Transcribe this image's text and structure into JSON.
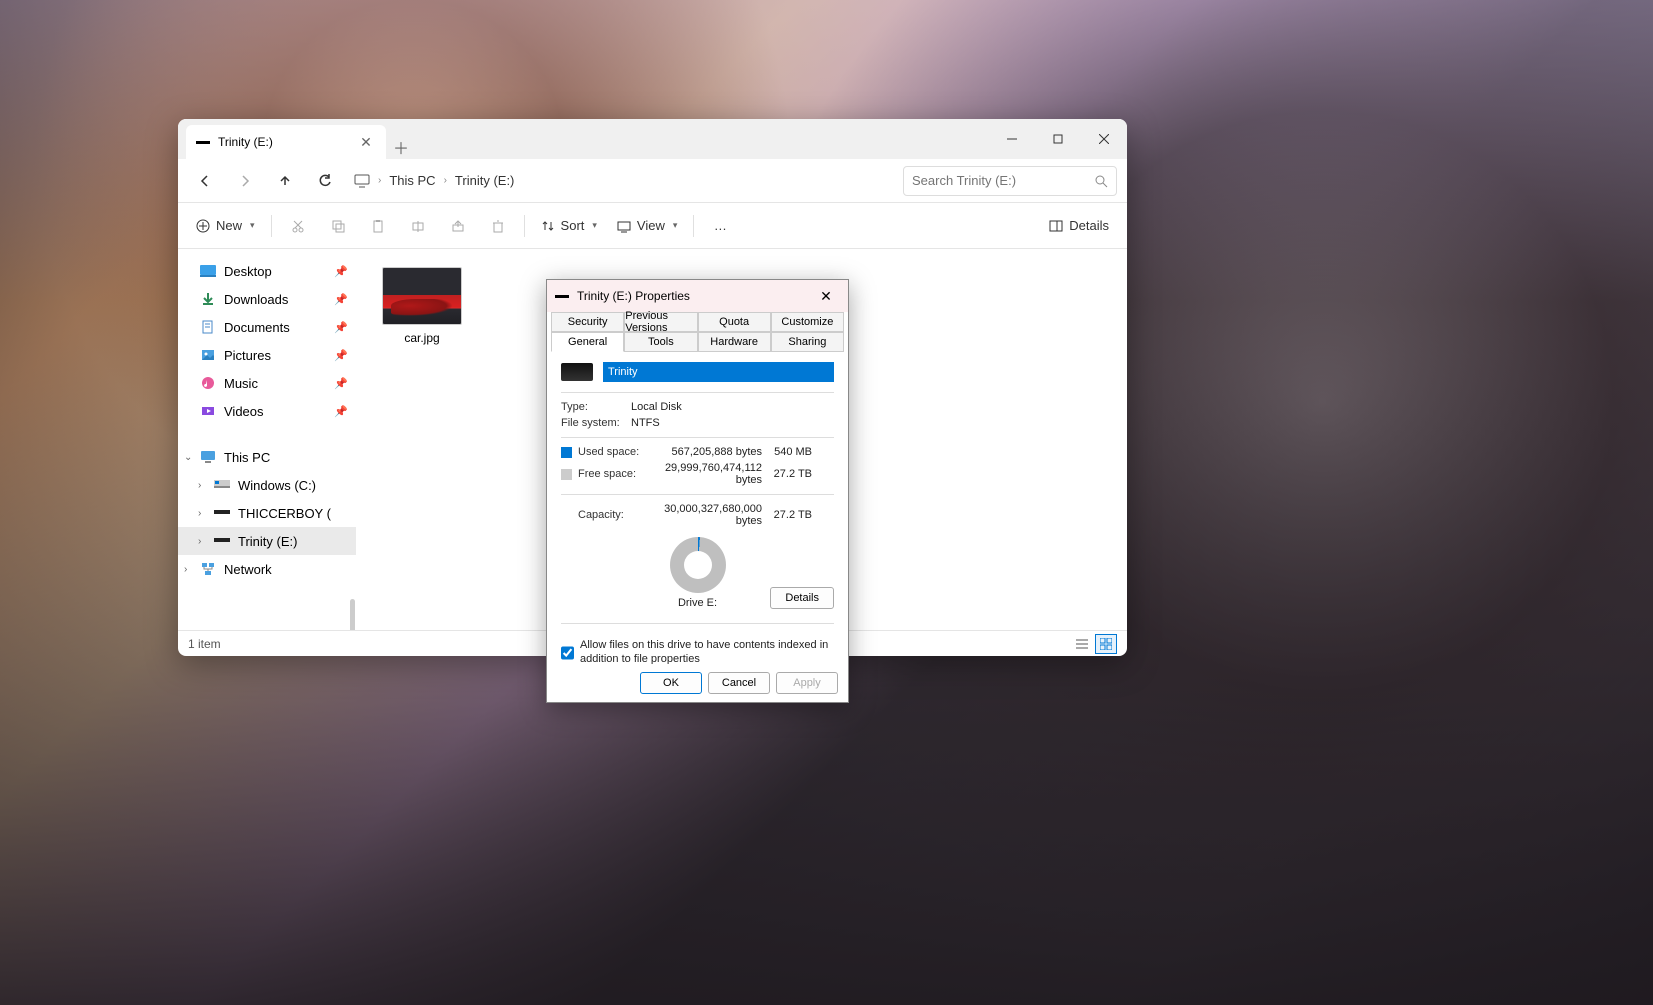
{
  "explorer": {
    "tab_title": "Trinity (E:)",
    "breadcrumb": {
      "items": [
        "This PC",
        "Trinity (E:)"
      ]
    },
    "search_placeholder": "Search Trinity (E:)",
    "toolbar": {
      "new": "New",
      "sort": "Sort",
      "view": "View",
      "details": "Details"
    },
    "sidebar": {
      "quick": [
        {
          "label": "Desktop",
          "icon": "desktop",
          "pinned": true
        },
        {
          "label": "Downloads",
          "icon": "downloads",
          "pinned": true
        },
        {
          "label": "Documents",
          "icon": "documents",
          "pinned": true
        },
        {
          "label": "Pictures",
          "icon": "pictures",
          "pinned": true
        },
        {
          "label": "Music",
          "icon": "music",
          "pinned": true
        },
        {
          "label": "Videos",
          "icon": "videos",
          "pinned": true
        }
      ],
      "thispc_label": "This PC",
      "drives": [
        {
          "label": "Windows (C:)"
        },
        {
          "label": "THICCERBOY ("
        },
        {
          "label": "Trinity (E:)",
          "selected": true
        }
      ],
      "network_label": "Network"
    },
    "files": [
      {
        "name": "car.jpg"
      }
    ],
    "status": "1 item"
  },
  "props": {
    "title": "Trinity (E:) Properties",
    "tabs_row1": [
      "Security",
      "Previous Versions",
      "Quota",
      "Customize"
    ],
    "tabs_row2": [
      "General",
      "Tools",
      "Hardware",
      "Sharing"
    ],
    "active_tab": "General",
    "drive_name": "Trinity",
    "type_label": "Type:",
    "type_value": "Local Disk",
    "fs_label": "File system:",
    "fs_value": "NTFS",
    "used_label": "Used space:",
    "used_bytes": "567,205,888 bytes",
    "used_human": "540 MB",
    "free_label": "Free space:",
    "free_bytes": "29,999,760,474,112 bytes",
    "free_human": "27.2 TB",
    "cap_label": "Capacity:",
    "cap_bytes": "30,000,327,680,000 bytes",
    "cap_human": "27.2 TB",
    "drive_letter": "Drive E:",
    "details_btn": "Details",
    "index_text": "Allow files on this drive to have contents indexed in addition to file properties",
    "btn_ok": "OK",
    "btn_cancel": "Cancel",
    "btn_apply": "Apply"
  }
}
